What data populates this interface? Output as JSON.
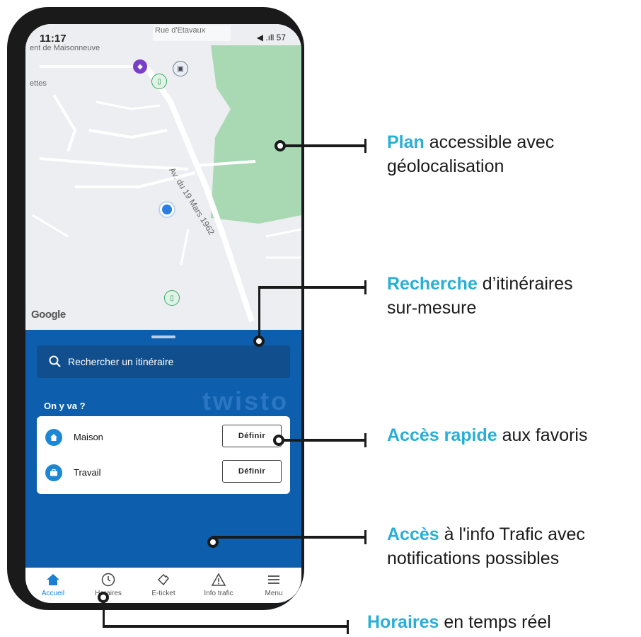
{
  "status_bar": {
    "time": "11:17",
    "icons": "◀ .ıll 57"
  },
  "map": {
    "street_top": "Rue d'Etavaux",
    "place_left": "ent de Maisonneuve",
    "place_left2": "ettes",
    "avenue": "Av. du 19 Mars 1962",
    "google": "Google"
  },
  "sheet": {
    "search_placeholder": "Rechercher un itinéraire",
    "section_title": "On y va ?",
    "brand": "twisto",
    "favorites": [
      {
        "label": "Maison",
        "button": "Définir",
        "icon": "home-icon"
      },
      {
        "label": "Travail",
        "button": "Définir",
        "icon": "briefcase-icon"
      }
    ]
  },
  "nav": [
    {
      "label": "Accueil",
      "icon": "home-icon",
      "active": true
    },
    {
      "label": "Horaires",
      "icon": "clock-icon",
      "active": false
    },
    {
      "label": "E-ticket",
      "icon": "ticket-icon",
      "active": false
    },
    {
      "label": "Info trafic",
      "icon": "warning-icon",
      "active": false
    },
    {
      "label": "Menu",
      "icon": "menu-icon",
      "active": false
    }
  ],
  "callouts": [
    {
      "bold": "Plan",
      "rest": " accessible avec",
      "line2": "géolocalisation"
    },
    {
      "bold": "Recherche",
      "rest": " d’itinéraires",
      "line2": "sur-mesure"
    },
    {
      "bold": "Accès rapide",
      "rest": " aux favoris",
      "line2": ""
    },
    {
      "bold": "Accès",
      "rest": " à l'info Trafic avec",
      "line2": "notifications possibles"
    },
    {
      "bold": "Horaires",
      "rest": " en temps réel",
      "line2": ""
    }
  ],
  "colors": {
    "accent": "#29aed6",
    "sheet": "#0d5fae",
    "park": "#a8d9b3"
  }
}
